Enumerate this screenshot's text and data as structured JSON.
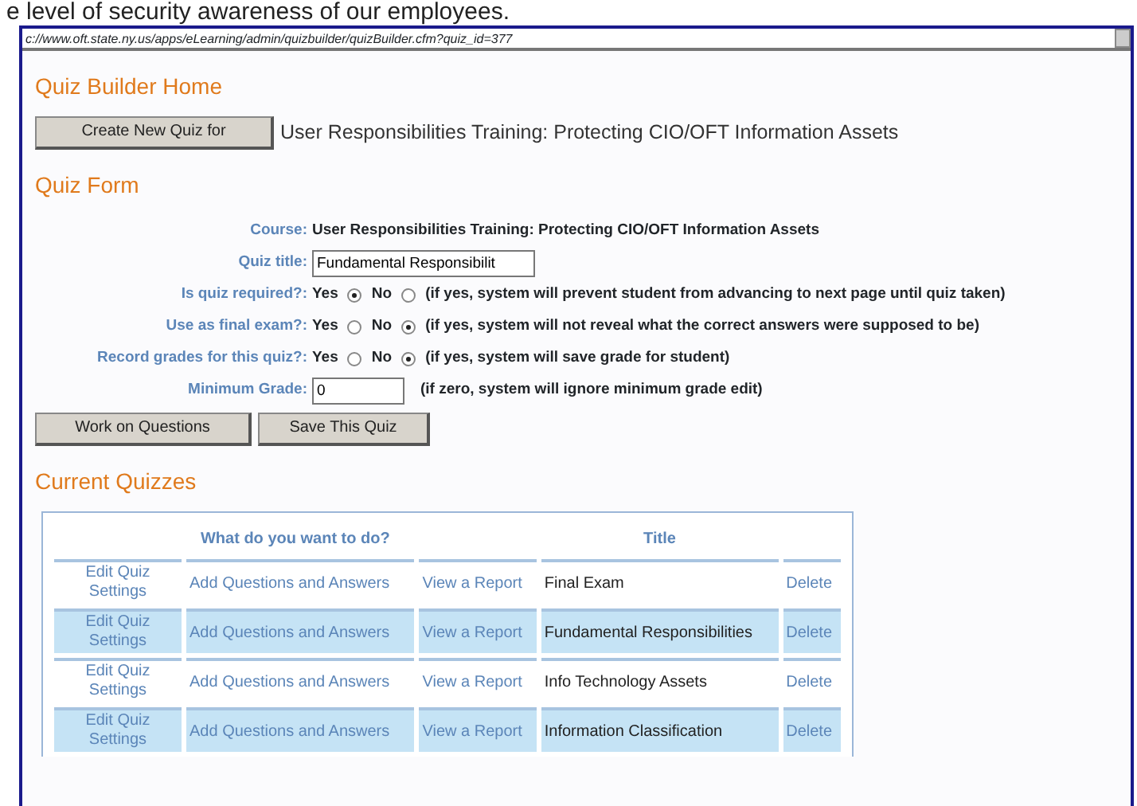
{
  "caption": "e level of security awareness of our employees.",
  "address_bar": {
    "url": "c://www.oft.state.ny.us/apps/eLearning/admin/quizbuilder/quizBuilder.cfm?quiz_id=377"
  },
  "home": {
    "heading": "Quiz Builder Home",
    "button": "Create New Quiz for",
    "course": "User Responsibilities Training: Protecting CIO/OFT Information Assets"
  },
  "form": {
    "heading": "Quiz Form",
    "fields": [
      {
        "kind": "text",
        "label": "Course:",
        "value": "User Responsibilities Training: Protecting CIO/OFT Information Assets"
      },
      {
        "kind": "input",
        "label": "Quiz title:",
        "value": "Fundamental Responsibilit"
      },
      {
        "kind": "radio",
        "label": "Is quiz required?:",
        "options": [
          {
            "label": "Yes",
            "selected": true
          },
          {
            "label": "No",
            "selected": false
          }
        ],
        "note": "(if yes, system will prevent student from advancing to next page until quiz taken)"
      },
      {
        "kind": "radio",
        "label": "Use as final exam?:",
        "options": [
          {
            "label": "Yes",
            "selected": false
          },
          {
            "label": "No",
            "selected": true
          }
        ],
        "note": "(if yes, system will not reveal what the correct answers were supposed to be)"
      },
      {
        "kind": "radio",
        "label": "Record grades for this quiz?:",
        "options": [
          {
            "label": "Yes",
            "selected": false
          },
          {
            "label": "No",
            "selected": true
          }
        ],
        "note": "(if yes, system will save grade for student)"
      },
      {
        "kind": "input",
        "label": "Minimum Grade:",
        "value": "0",
        "note": "(if zero, system will ignore minimum grade edit)"
      }
    ],
    "buttons": [
      "Work on Questions",
      "Save This Quiz"
    ]
  },
  "quizzes": {
    "heading": "Current Quizzes",
    "columns": [
      "What do you want to do?",
      "Title"
    ],
    "rows": [
      {
        "shaded": false,
        "edit": "Edit Quiz Settings",
        "add": "Add Questions and Answers",
        "report": "View a Report",
        "title": "Final Exam",
        "delete": "Delete"
      },
      {
        "shaded": true,
        "edit": "Edit Quiz Settings",
        "add": "Add Questions and Answers",
        "report": "View a Report",
        "title": "Fundamental Responsibilities",
        "delete": "Delete"
      },
      {
        "shaded": false,
        "edit": "Edit Quiz Settings",
        "add": "Add Questions and Answers",
        "report": "View a Report",
        "title": "Info Technology Assets",
        "delete": "Delete"
      },
      {
        "shaded": true,
        "edit": "Edit Quiz Settings",
        "add": "Add Questions and Answers",
        "report": "View a Report",
        "title": "Information Classification",
        "delete": "Delete"
      }
    ]
  }
}
